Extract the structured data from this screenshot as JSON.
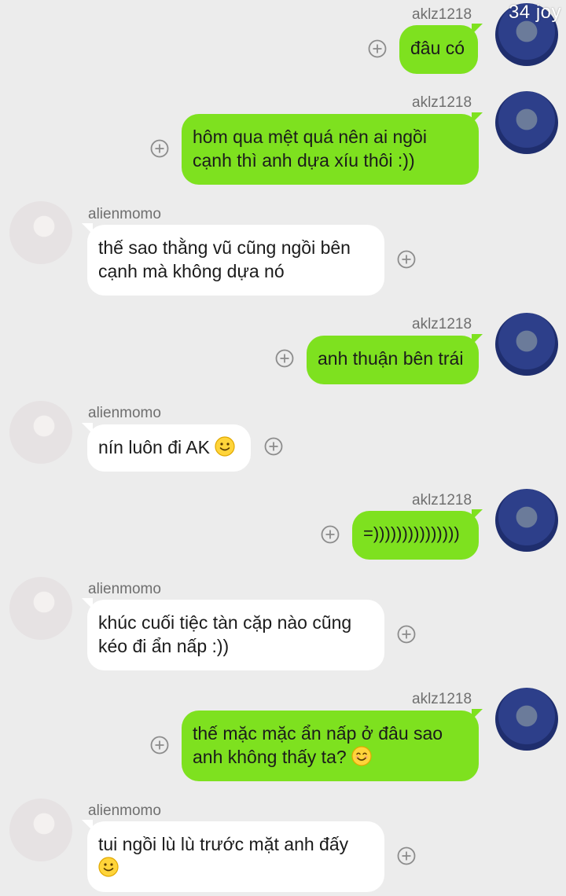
{
  "watermark": "34 joy",
  "colors": {
    "my_bubble": "#7ee11f",
    "their_bubble": "#ffffff",
    "background": "#ececec"
  },
  "messages": [
    {
      "sender": "aklz1218",
      "side": "right",
      "text": "đâu có"
    },
    {
      "sender": "aklz1218",
      "side": "right",
      "lines": [
        "hôm qua mệt quá nên ai ngồi",
        "cạnh thì anh dựa xíu thôi :))"
      ]
    },
    {
      "sender": "alienmomo",
      "side": "left",
      "lines": [
        "thế sao thằng vũ cũng ngồi bên",
        "cạnh mà không dựa nó"
      ]
    },
    {
      "sender": "aklz1218",
      "side": "right",
      "text": "anh thuận bên trái"
    },
    {
      "sender": "alienmomo",
      "side": "left",
      "text": "nín luôn đi AK",
      "emoji": "slight-smile-emoji"
    },
    {
      "sender": "aklz1218",
      "side": "right",
      "text": "=)))))))))))))))"
    },
    {
      "sender": "alienmomo",
      "side": "left",
      "lines": [
        "khúc cuối tiệc tàn cặp nào cũng",
        "kéo đi ẩn nấp :))"
      ]
    },
    {
      "sender": "aklz1218",
      "side": "right",
      "lines": [
        "thế mặc mặc ẩn nấp ở đâu sao",
        "anh không thấy ta?"
      ],
      "emoji": "smiling-eyes-emoji"
    },
    {
      "sender": "alienmomo",
      "side": "left",
      "lines": [
        "tui ngồi lù lù trước mặt anh đấy"
      ],
      "emoji": "slight-smile-emoji"
    }
  ],
  "icons": {
    "add": "circle-plus-icon",
    "avatar_me": "hooded-person-avatar",
    "avatar_other": "person-avatar"
  }
}
